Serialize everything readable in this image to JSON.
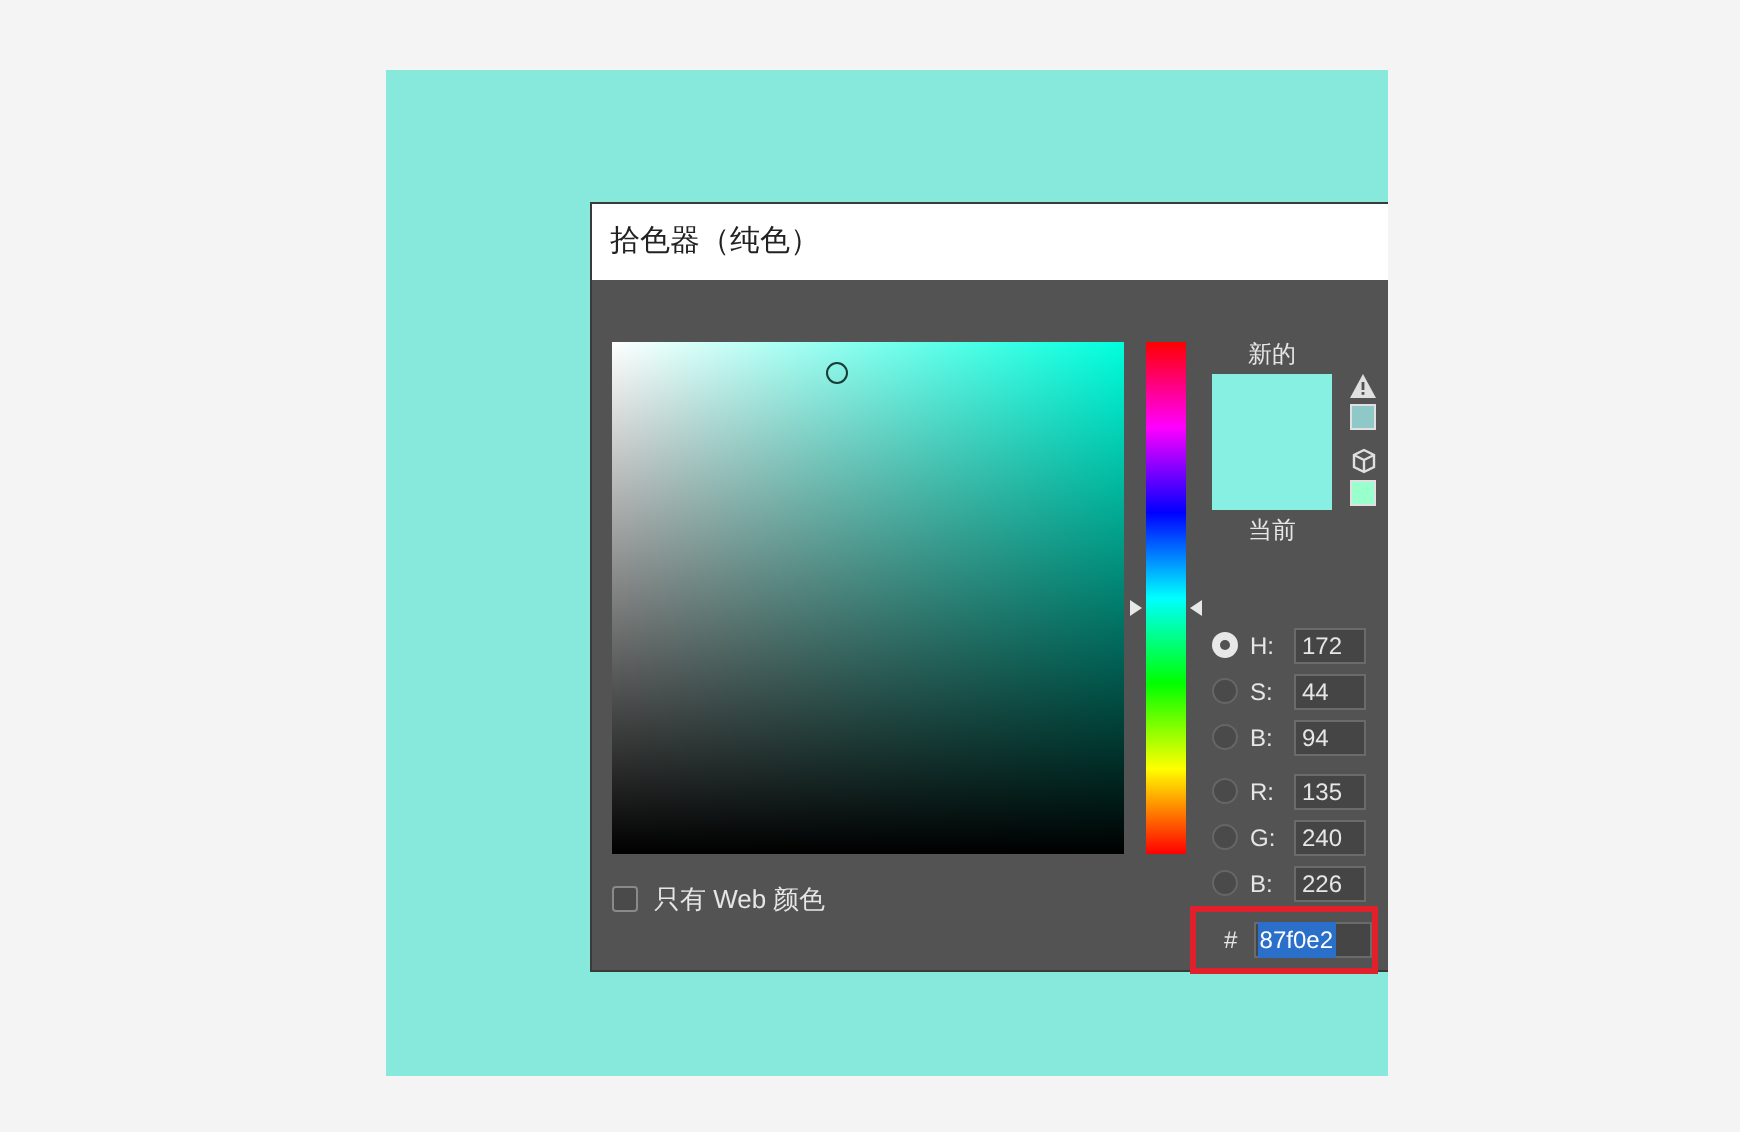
{
  "window": {
    "title": "拾色器（纯色）"
  },
  "hue_slider": {
    "level": 0.48
  },
  "preview": {
    "new_label": "新的",
    "current_label": "当前"
  },
  "gamut_warning": {
    "color": "#8ec9c7"
  },
  "web_safe": {
    "color": "#99ffcc"
  },
  "hsb_fields": [
    {
      "label": "H:",
      "value": "172",
      "selected": true
    },
    {
      "label": "S:",
      "value": "44",
      "selected": false
    },
    {
      "label": "B:",
      "value": "94",
      "selected": false
    }
  ],
  "rgb_fields": [
    {
      "label": "R:",
      "value": "135",
      "selected": false
    },
    {
      "label": "G:",
      "value": "240",
      "selected": false
    },
    {
      "label": "B:",
      "value": "226",
      "selected": false
    }
  ],
  "hex": {
    "label": "#",
    "value": "87f0e2",
    "text_selected": true,
    "outlined": true
  },
  "web_only": {
    "label": "只有 Web 颜色",
    "checked": false
  }
}
